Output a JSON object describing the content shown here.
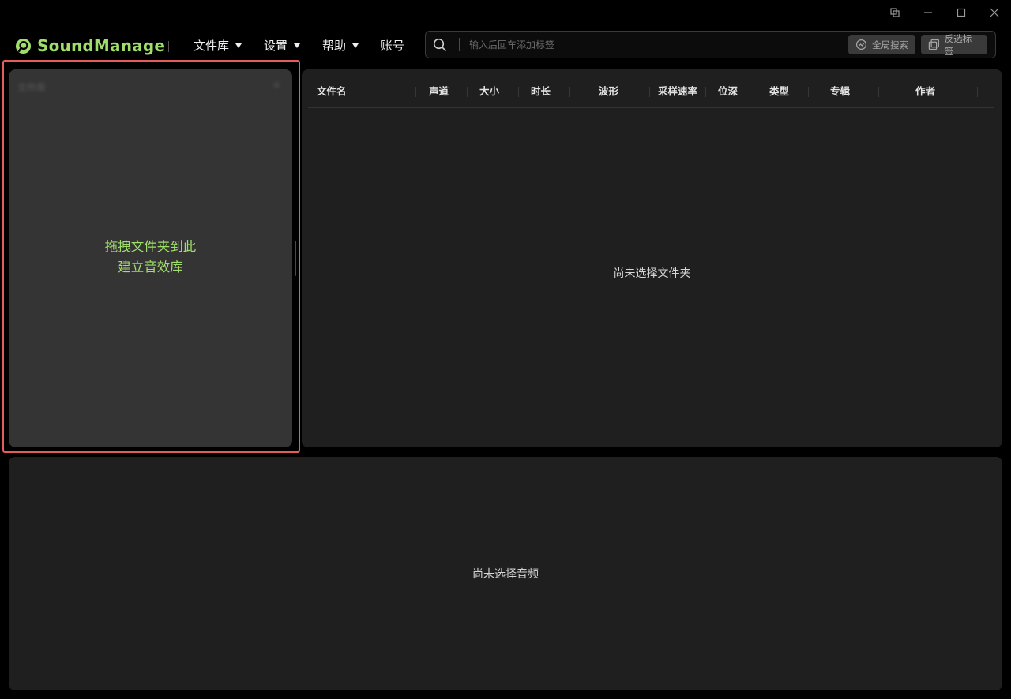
{
  "app": {
    "name": "SoundManage"
  },
  "nav": {
    "library": "文件库",
    "settings": "设置",
    "help": "帮助",
    "account": "账号"
  },
  "search": {
    "placeholder": "输入后回车添加标签",
    "global_search": "全局搜索",
    "invert_tags": "反选标签"
  },
  "library": {
    "title": "文件库",
    "drop_line1": "拖拽文件夹到此",
    "drop_line2": "建立音效库"
  },
  "file_table": {
    "columns": [
      "文件名",
      "声道",
      "大小",
      "时长",
      "波形",
      "采样速率",
      "位深",
      "类型",
      "专辑",
      "作者"
    ],
    "empty_text": "尚未选择文件夹"
  },
  "audio_panel": {
    "empty_text": "尚未选择音频"
  },
  "colors": {
    "accent": "#9fde6a",
    "highlight": "#e65c5c",
    "panel": "#1f1f1f",
    "library_panel": "#343434"
  }
}
